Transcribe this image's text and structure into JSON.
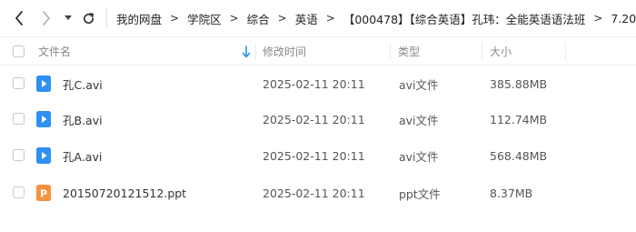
{
  "nav": {
    "back_icon": "chevron-left-icon",
    "forward_icon": "chevron-right-icon",
    "history_icon": "caret-down-icon",
    "refresh_icon": "refresh-icon"
  },
  "breadcrumb": [
    "我的网盘",
    "学院区",
    "综合",
    "英语",
    "【000478】【综合英语】孔玮：全能英语语法班",
    "7.20"
  ],
  "columns": {
    "name": "文件名",
    "modified": "修改时间",
    "type": "类型",
    "size": "大小"
  },
  "colors": {
    "video_icon": "#2f8ff2",
    "ppt_icon": "#f5923e",
    "sort_arrow": "#2f8ff2"
  },
  "files": [
    {
      "name": "孔C.avi",
      "modified": "2025-02-11 20:11",
      "type": "avi文件",
      "size": "385.88MB",
      "icon": "video-file-icon"
    },
    {
      "name": "孔B.avi",
      "modified": "2025-02-11 20:11",
      "type": "avi文件",
      "size": "112.74MB",
      "icon": "video-file-icon"
    },
    {
      "name": "孔A.avi",
      "modified": "2025-02-11 20:11",
      "type": "avi文件",
      "size": "568.48MB",
      "icon": "video-file-icon"
    },
    {
      "name": "20150720121512.ppt",
      "modified": "2025-02-11 20:11",
      "type": "ppt文件",
      "size": "8.37MB",
      "icon": "ppt-file-icon"
    }
  ]
}
